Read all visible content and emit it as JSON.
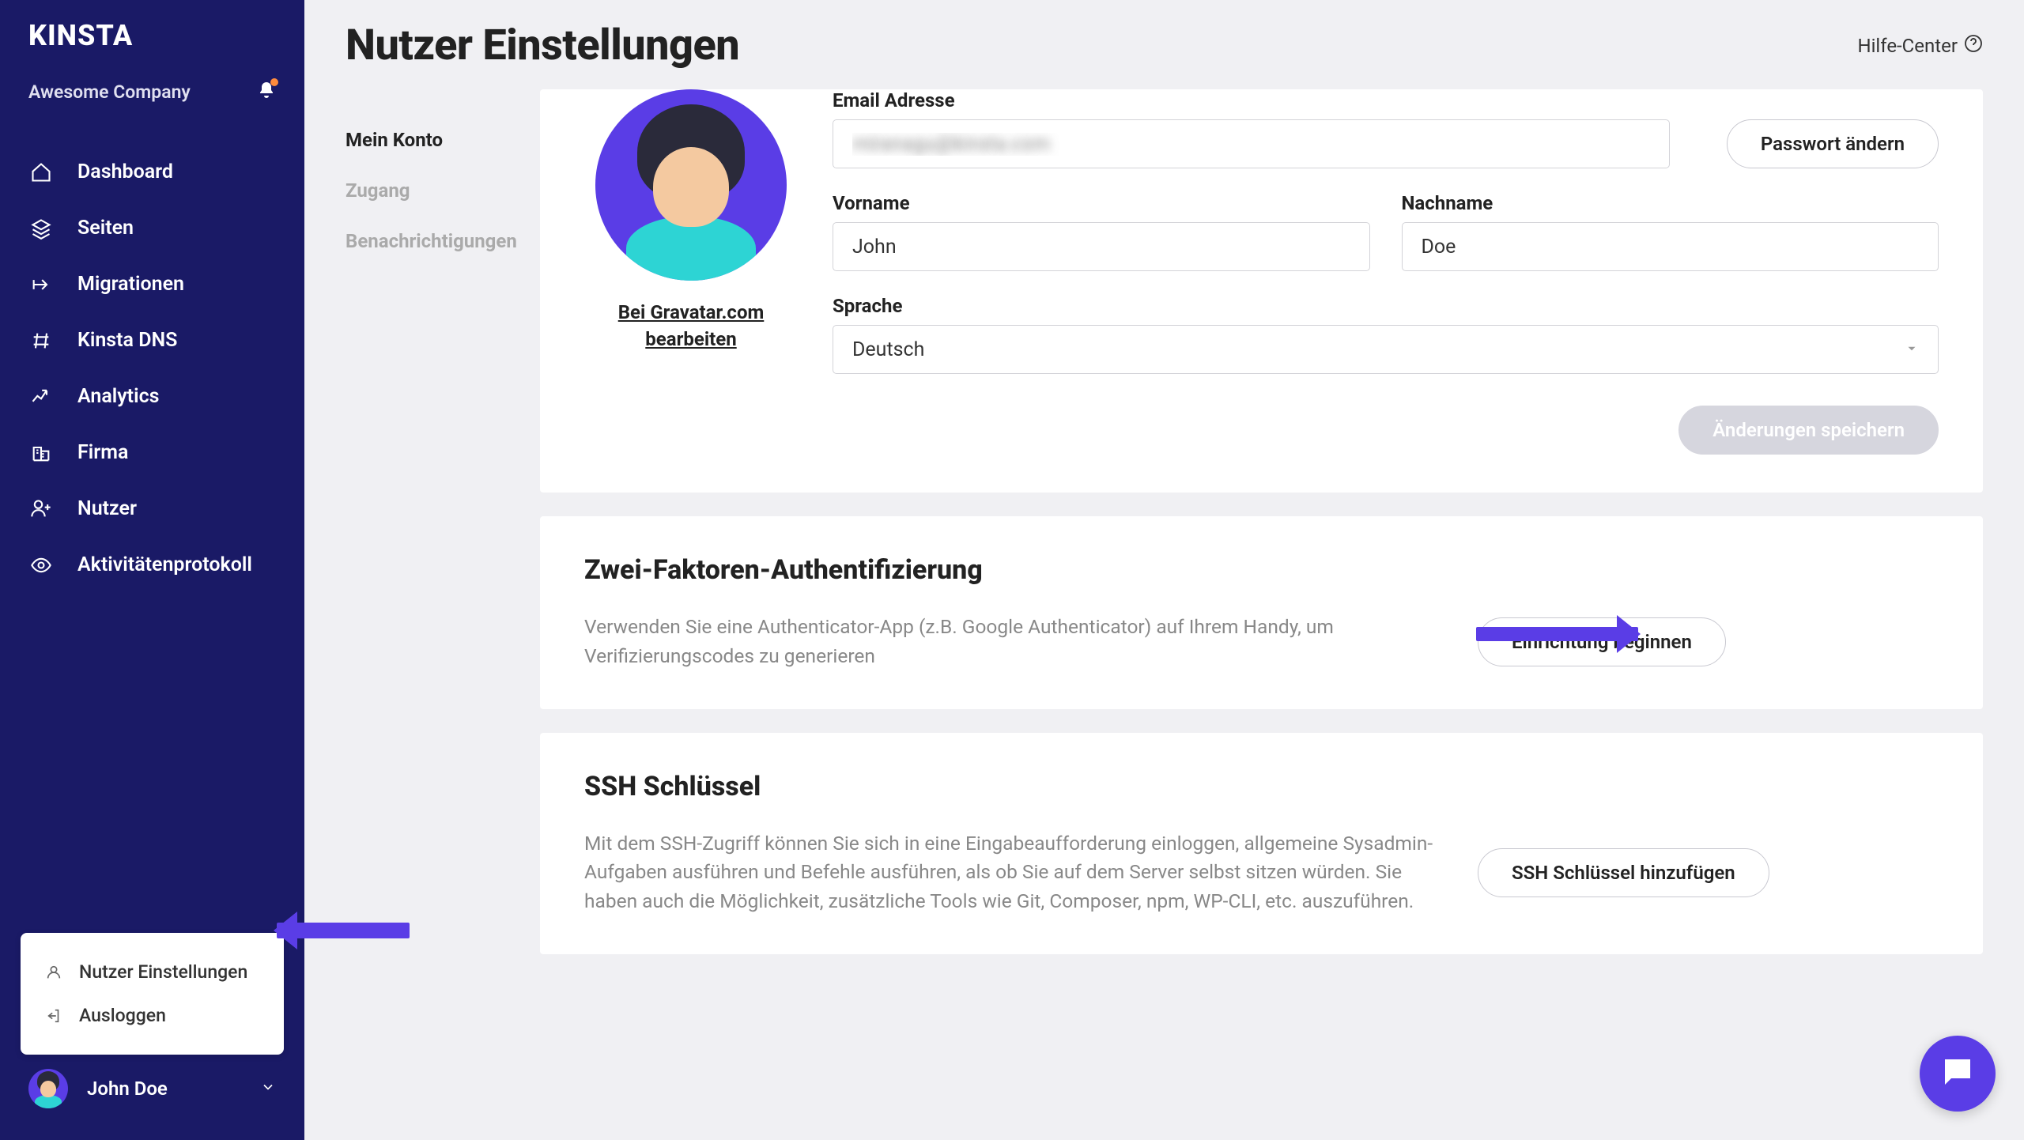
{
  "brand": "KINSTA",
  "company": "Awesome Company",
  "nav": [
    {
      "label": "Dashboard"
    },
    {
      "label": "Seiten"
    },
    {
      "label": "Migrationen"
    },
    {
      "label": "Kinsta DNS"
    },
    {
      "label": "Analytics"
    },
    {
      "label": "Firma"
    },
    {
      "label": "Nutzer"
    },
    {
      "label": "Aktivitätenprotokoll"
    }
  ],
  "popup": {
    "settings": "Nutzer Einstellungen",
    "logout": "Ausloggen"
  },
  "footer_user": "John Doe",
  "page_title": "Nutzer Einstellungen",
  "help": "Hilfe-Center",
  "subnav": [
    {
      "label": "Mein Konto",
      "active": true
    },
    {
      "label": "Zugang"
    },
    {
      "label": "Benachrichtigungen"
    }
  ],
  "gravatar_link": "Bei Gravatar.com bearbeiten",
  "fields": {
    "email_label": "Email Adresse",
    "email_value": "miranagu@kinsta.com",
    "firstname_label": "Vorname",
    "firstname_value": "John",
    "lastname_label": "Nachname",
    "lastname_value": "Doe",
    "language_label": "Sprache",
    "language_value": "Deutsch"
  },
  "buttons": {
    "change_password": "Passwort ändern",
    "save_changes": "Änderungen speichern",
    "begin_setup": "Einrichtung beginnen",
    "add_ssh_key": "SSH Schlüssel hinzufügen"
  },
  "twofa": {
    "title": "Zwei-Faktoren-Authentifizierung",
    "desc": "Verwenden Sie eine Authenticator-App (z.B. Google Authenticator) auf Ihrem Handy, um Verifizierungscodes zu generieren"
  },
  "ssh": {
    "title": "SSH Schlüssel",
    "desc": "Mit dem SSH-Zugriff können Sie sich in eine Eingabeaufforderung einloggen, allgemeine Sysadmin-Aufgaben ausführen und Befehle ausführen, als ob Sie auf dem Server selbst sitzen würden. Sie haben auch die Möglichkeit, zusätzliche Tools wie Git, Composer, npm, WP-CLI, etc. auszuführen."
  }
}
